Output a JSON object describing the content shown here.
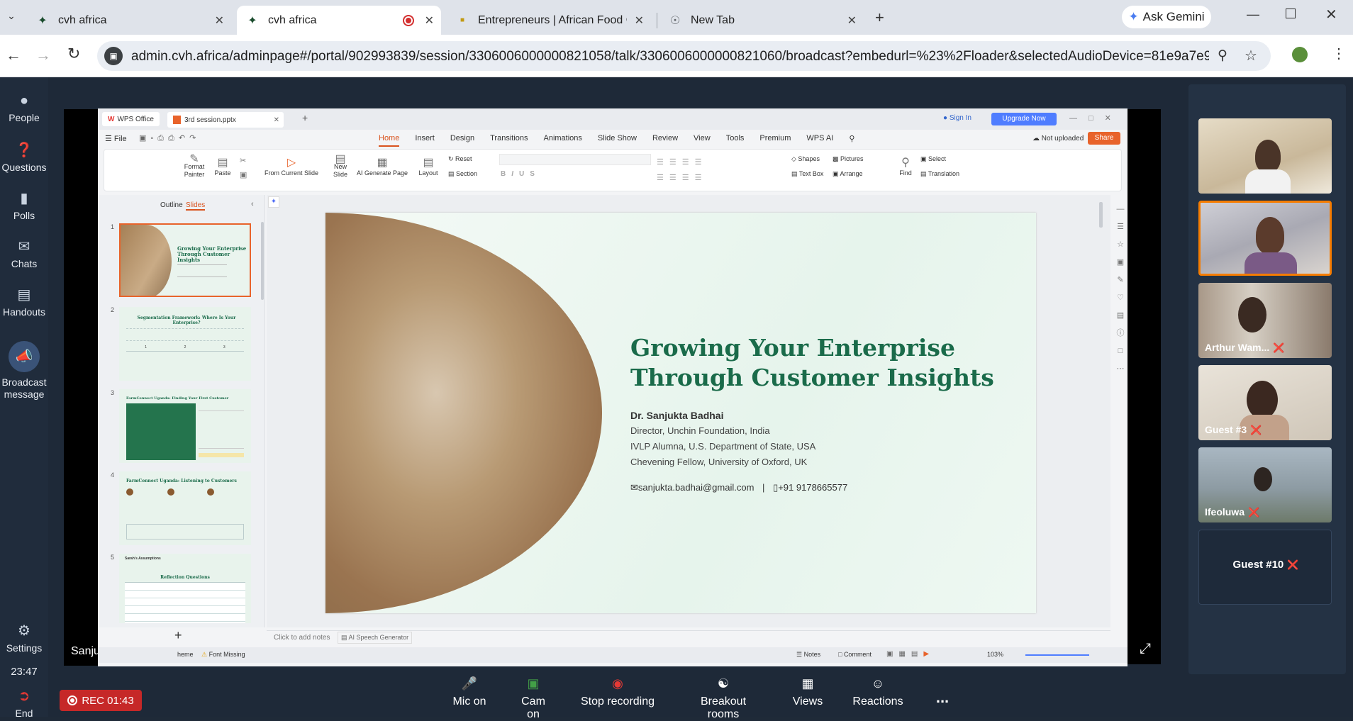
{
  "browser": {
    "tabs": [
      {
        "title": "cvh africa",
        "active": false
      },
      {
        "title": "cvh africa",
        "active": true
      },
      {
        "title": "Entrepreneurs | African Food Ch",
        "active": false
      },
      {
        "title": "New Tab",
        "active": false
      }
    ],
    "gemini_label": "Ask Gemini",
    "url": "admin.cvh.africa/adminpage#/portal/902993839/session/3306006000000821058/talk/3306006000000821060/broadcast?embedurl=%23%2Floader&selectedAudioDevice=81e9a7e97756f2494e58..."
  },
  "left_nav": {
    "items": [
      {
        "label": "People",
        "icon": "people-icon"
      },
      {
        "label": "Questions",
        "icon": "question-icon"
      },
      {
        "label": "Polls",
        "icon": "poll-icon"
      },
      {
        "label": "Chats",
        "icon": "chat-icon"
      },
      {
        "label": "Handouts",
        "icon": "handout-icon"
      },
      {
        "label": "Broadcast message",
        "icon": "megaphone-icon"
      }
    ],
    "settings_label": "Settings",
    "clock": "23:47",
    "end_label": "End"
  },
  "wps": {
    "app_tab": "WPS Office",
    "file_tab": "3rd session.pptx",
    "sign_in": "Sign In",
    "upgrade": "Upgrade Now",
    "menu_file": "File",
    "ribbon_tabs": [
      "Home",
      "Insert",
      "Design",
      "Transitions",
      "Animations",
      "Slide Show",
      "Review",
      "View",
      "Tools",
      "Premium",
      "WPS AI"
    ],
    "not_uploaded": "Not uploaded",
    "share": "Share",
    "ribbon": {
      "format_painter": "Format Painter",
      "paste": "Paste",
      "from_current_slide": "From Current Slide",
      "new_slide": "New Slide",
      "ai_generate_page": "AI Generate Page",
      "layout": "Layout",
      "reset": "Reset",
      "section": "Section",
      "shapes": "Shapes",
      "pictures": "Pictures",
      "text_box": "Text Box",
      "arrange": "Arrange",
      "find": "Find",
      "select": "Select",
      "translation": "Translation"
    },
    "panel_tabs": {
      "outline": "Outline",
      "slides": "Slides"
    },
    "thumbnails": [
      {
        "num": "1",
        "title": "Growing Your Enterprise Through Customer Insights"
      },
      {
        "num": "2",
        "title": "Segmentation Framework: Where Is Your Enterprise?",
        "cols": [
          "1",
          "2",
          "3"
        ]
      },
      {
        "num": "3",
        "title": "FarmConnect Uganda: Finding Your First Customer"
      },
      {
        "num": "4",
        "title": "FarmConnect Uganda: Listening to Customers"
      },
      {
        "num": "5",
        "title": "Reflection Questions",
        "small_heading": "Sarah's Assumptions"
      }
    ],
    "slide": {
      "title_line1": "Growing Your Enterprise",
      "title_line2": "Through Customer Insights",
      "presenter": "Dr. Sanjukta Badhai",
      "line1": "Director, Unchin Foundation, India",
      "line2": "IVLP Alumna, U.S. Department of State, USA",
      "line3": "Chevening Fellow, University of Oxford, UK",
      "email": "sanjukta.badhai@gmail.com",
      "separator": "|",
      "phone": "+91 9178665577"
    },
    "notes_placeholder": "Click to add notes",
    "ai_speech": "AI Speech Generator",
    "status": {
      "theme": "heme",
      "font_missing": "Font Missing",
      "notes": "Notes",
      "comment": "Comment",
      "zoom": "103%"
    }
  },
  "presenter_label": "Sanjukta Badhai",
  "participants": [
    {
      "name": "",
      "muted": false
    },
    {
      "name": "",
      "muted": false,
      "highlight": true
    },
    {
      "name": "Arthur Wam...",
      "muted": true
    },
    {
      "name": "Guest #3",
      "muted": true
    },
    {
      "name": "Ifeoluwa",
      "muted": true
    },
    {
      "name": "Guest #10",
      "muted": true
    }
  ],
  "bottom_bar": {
    "rec": "REC 01:43",
    "mic": "Mic on",
    "cam": "Cam on",
    "stop_recording": "Stop recording",
    "breakout": "Breakout rooms",
    "views": "Views",
    "reactions": "Reactions",
    "more": "..."
  },
  "colors": {
    "accent_green": "#1a6b4a",
    "app_bg": "#1e2938",
    "rec_red": "#d32f2f",
    "participant_highlight": "#f57c00"
  }
}
